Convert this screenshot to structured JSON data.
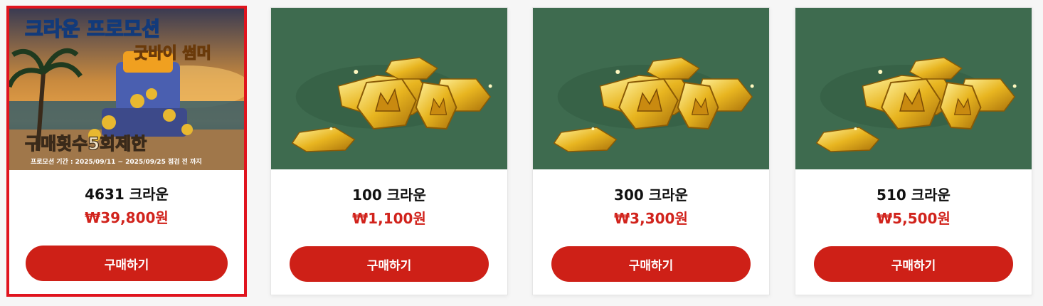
{
  "products": [
    {
      "name": "4631 크라운",
      "price": "₩39,800원",
      "buy_label": "구매하기",
      "selected": true,
      "banner": {
        "headline": "크라운 프로모션",
        "subhead": "굿바이 썸머",
        "limit": "구매횟수5회제한",
        "period": "프로모션 기간 : 2025/09/11 ~ 2025/09/25 점검 전 까지"
      }
    },
    {
      "name": "100 크라운",
      "price": "₩1,100원",
      "buy_label": "구매하기",
      "selected": false
    },
    {
      "name": "300 크라운",
      "price": "₩3,300원",
      "buy_label": "구매하기",
      "selected": false
    },
    {
      "name": "510 크라운",
      "price": "₩5,500원",
      "buy_label": "구매하기",
      "selected": false
    }
  ],
  "colors": {
    "accent": "#ce2017",
    "price": "#d1231c",
    "selected_border": "#e0141e",
    "thumb_bg": "#3e6b4f"
  }
}
